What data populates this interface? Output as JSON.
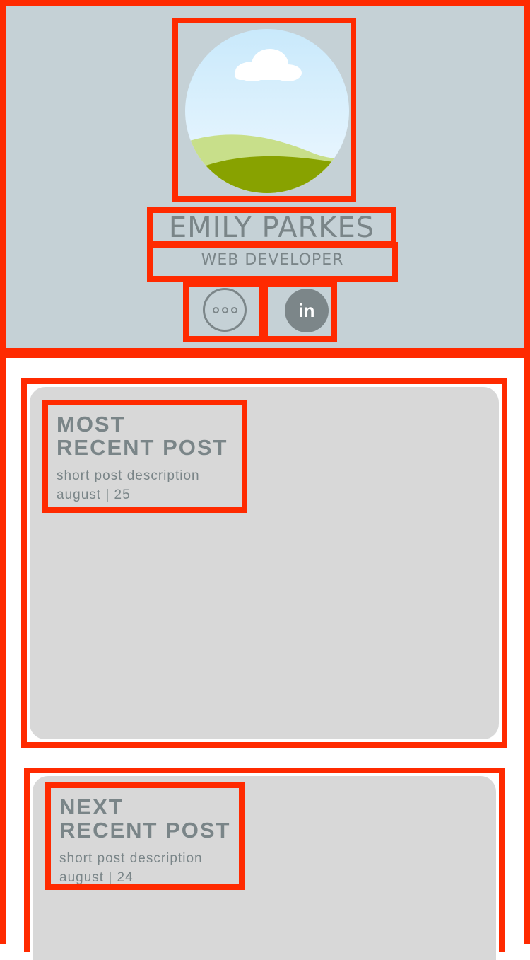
{
  "profile": {
    "name": "EMILY PARKES",
    "role": "WEB DEVELOPER"
  },
  "icons": {
    "avatar": "avatar-landscape-icon",
    "more": "more-options-icon",
    "linkedin": "linkedin-icon",
    "linkedin_text": "in"
  },
  "colors": {
    "header_bg": "#c5d1d6",
    "text": "#7a8588",
    "card_bg": "#d8d8d8",
    "outline": "#ff2a00"
  },
  "posts": [
    {
      "title_line1": "MOST",
      "title_line2": "RECENT POST",
      "description": "short post description",
      "date": "august | 25"
    },
    {
      "title_line1": "NEXT",
      "title_line2": "RECENT POST",
      "description": "short post description",
      "date": "august | 24"
    }
  ]
}
